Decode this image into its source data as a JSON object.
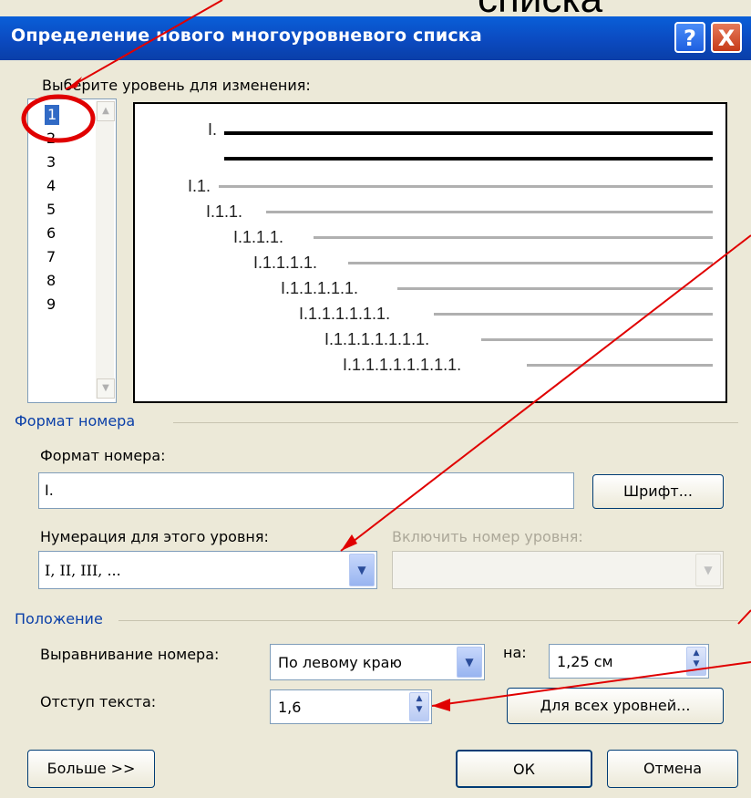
{
  "overlay": {
    "slide_fragment": "списка"
  },
  "window": {
    "title": "Определение нового многоуровневого списка",
    "help_icon": "?",
    "close_icon": "X"
  },
  "level_select": {
    "label": "Выберите уровень для изменения:",
    "levels": [
      "1",
      "2",
      "3",
      "4",
      "5",
      "6",
      "7",
      "8",
      "9"
    ],
    "selected": "1"
  },
  "preview": {
    "labels": [
      "I.",
      "I.1.",
      "I.1.1.",
      "I.1.1.1.",
      "I.1.1.1.1.",
      "I.1.1.1.1.1.",
      "I.1.1.1.1.1.1.",
      "I.1.1.1.1.1.1.1.",
      "I.1.1.1.1.1.1.1.1."
    ]
  },
  "number_format": {
    "section_title": "Формат номера",
    "format_label": "Формат номера:",
    "format_value": "I.",
    "font_button": "Шрифт...",
    "numbering_label": "Нумерация для этого уровня:",
    "numbering_value": "I, II, III, ...",
    "include_level_label": "Включить номер уровня:",
    "include_level_value": ""
  },
  "position": {
    "section_title": "Положение",
    "align_label": "Выравнивание номера:",
    "align_value": "По левому краю",
    "at_label": "на:",
    "at_value": "1,25 см",
    "indent_label": "Отступ текста:",
    "indent_value": "1,6",
    "all_levels_button": "Для всех уровней..."
  },
  "footer": {
    "more_button": "Больше >>",
    "ok_button": "ОК",
    "cancel_button": "Отмена"
  },
  "colors": {
    "titlebar": "#0b4ac0",
    "section": "#0a3fa8",
    "highlight": "#316ac5",
    "annotation": "#e00000"
  }
}
